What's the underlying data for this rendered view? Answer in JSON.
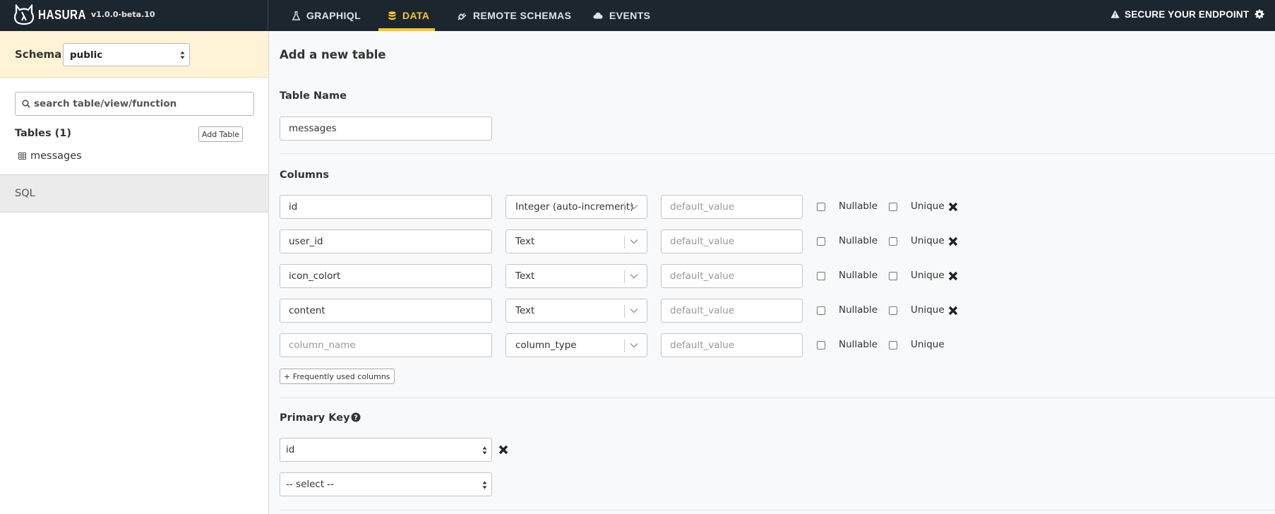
{
  "navbar": {
    "brand_name": "HASURA",
    "version": "v1.0.0-beta.10",
    "tabs": [
      {
        "label": "GRAPHIQL",
        "icon": "flask-icon",
        "active": false
      },
      {
        "label": "DATA",
        "icon": "database-icon",
        "active": true
      },
      {
        "label": "REMOTE SCHEMAS",
        "icon": "plug-icon",
        "active": false
      },
      {
        "label": "EVENTS",
        "icon": "cloud-icon",
        "active": false
      }
    ],
    "secure_endpoint": "SECURE YOUR ENDPOINT",
    "accent_color": "#ffc627",
    "background_color": "#1c262f"
  },
  "sidebar": {
    "schema_label": "Schema:",
    "schema_value": "public",
    "search_placeholder": "search table/view/function",
    "tables_header": "Tables (1)",
    "add_table_label": "Add Table",
    "tables": [
      {
        "name": "messages"
      }
    ],
    "sql_label": "SQL",
    "schema_bar_color": "#fff3d5"
  },
  "main": {
    "title": "Add a new table",
    "table_name_label": "Table Name",
    "table_name_value": "messages",
    "columns_label": "Columns",
    "columns": [
      {
        "name": "id",
        "type": "Integer (auto-increment)",
        "default_placeholder": "default_value",
        "nullable_label": "Nullable",
        "unique_label": "Unique",
        "removable": true
      },
      {
        "name": "user_id",
        "type": "Text",
        "default_placeholder": "default_value",
        "nullable_label": "Nullable",
        "unique_label": "Unique",
        "removable": true
      },
      {
        "name": "icon_colort",
        "type": "Text",
        "default_placeholder": "default_value",
        "nullable_label": "Nullable",
        "unique_label": "Unique",
        "removable": true
      },
      {
        "name": "content",
        "type": "Text",
        "default_placeholder": "default_value",
        "nullable_label": "Nullable",
        "unique_label": "Unique",
        "removable": true
      },
      {
        "name": "",
        "name_placeholder": "column_name",
        "type": "column_type",
        "default_placeholder": "default_value",
        "nullable_label": "Nullable",
        "unique_label": "Unique",
        "removable": false
      }
    ],
    "frequent_columns_label": "+ Frequently used columns",
    "primary_key_label": "Primary Key",
    "primary_keys": [
      {
        "value": "id",
        "removable": true
      },
      {
        "value": "-- select --",
        "removable": false
      }
    ]
  }
}
